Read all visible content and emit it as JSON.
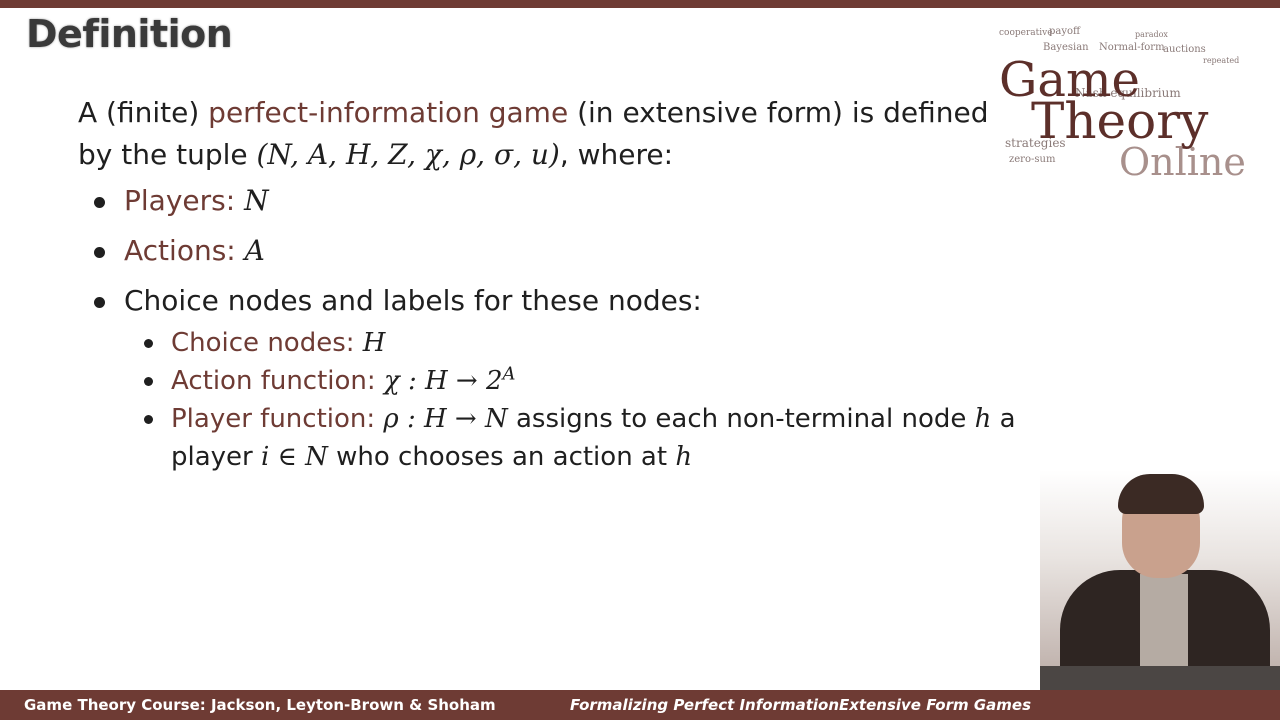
{
  "slide": {
    "title": "Definition",
    "intro_prefix": "A (finite) ",
    "intro_accent": "perfect-information game",
    "intro_suffix": " (in extensive form) is defined by the tuple ",
    "tuple": "(N, A, H, Z, χ, ρ, σ, u)",
    "intro_end": ", where:",
    "bullets": [
      {
        "label": "Players: ",
        "math": "N"
      },
      {
        "label": "Actions: ",
        "math": "A"
      },
      {
        "text": "Choice nodes and labels for these nodes:"
      }
    ],
    "sub_bullets": [
      {
        "label": "Choice nodes: ",
        "math": "H"
      },
      {
        "label": "Action function: ",
        "math": "χ : H → 2",
        "sup": "A"
      },
      {
        "label": "Player function: ",
        "math": "ρ : H → N",
        "t1": " assigns to each non-terminal node ",
        "math2": "h",
        "t2": " a player ",
        "math3": "i ∈ N",
        "t3": " who chooses an action at ",
        "math4": "h"
      }
    ]
  },
  "logo": {
    "line1": "Game",
    "line2": "Theory",
    "line3": "Online",
    "cloud_words": [
      "payoff",
      "cooperative",
      "Bayesian",
      "Normal-form",
      "auctions",
      "paradox",
      "repeated",
      "Nash equilibrium",
      "strategies",
      "zero-sum"
    ]
  },
  "footer": {
    "left": "Game Theory Course: Jackson, Leyton-Brown & Shoham",
    "right": "Formalizing Perfect InformationExtensive Form Games"
  },
  "colors": {
    "accent": "#6e3b34",
    "text": "#1f1f1f"
  }
}
